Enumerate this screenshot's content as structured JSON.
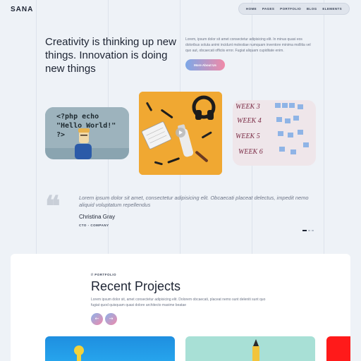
{
  "brand": "SANA",
  "nav": [
    "HOME",
    "PAGES",
    "PORTFOLIO",
    "BLOG",
    "ELEMENTS"
  ],
  "hero": {
    "title": "Creativity is thinking up new things. Innovation is doing new things",
    "text": "Lorem, ipsum dolor sit amet consectetur adipisicing elit. In minus quasi eos doloribus soluta animi incidunt molestiae numquam inventore minima mollitia vel quo aut, obcaecati officiis error. Fugiat aliquam cupiditate enim.",
    "button": "More About Us"
  },
  "code_image": {
    "code_text": "<?php echo\n\"Hello World!\"\n?>"
  },
  "week_image": {
    "labels": [
      "WEEK 3",
      "WEEK 4",
      "WEEK 5",
      "WEEK 6"
    ]
  },
  "testimonial": {
    "quote": "Lorem ipsum dolor sit amet, consectetur adipisicing elit. Obcaecati placeat delectus, impedit nemo aliquid voluptatum repellendus",
    "name": "Christina Gray",
    "role": "CTO - COMPANY"
  },
  "portfolio": {
    "kicker": "// PORTFOLIO",
    "title": "Recent Projects",
    "text": "Lorem ipsum dolor sit, amet consectetur adipisicing elit. Dolorem obcaecati, placeat nemo sunt deleniti sunt quo fugiat quod quisquam quasi dolore architecto maxime beatae",
    "prev": "←",
    "next": "→"
  },
  "colors": {
    "background": "#eef2f7",
    "accent_gradient_start": "#7ca8e8",
    "accent_gradient_end": "#f08aa8",
    "text_dark": "#1d2433"
  }
}
